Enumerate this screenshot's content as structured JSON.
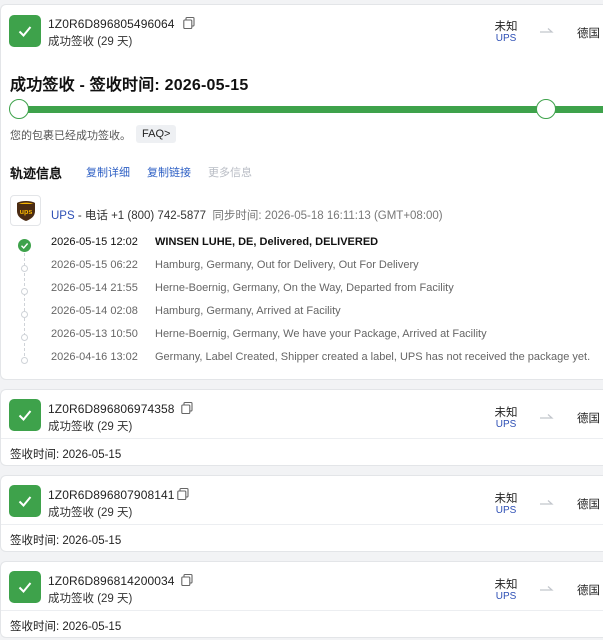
{
  "shipments": [
    {
      "tracking_no": "1Z0R6D896805496064",
      "status_sub": "成功签收 (29 天)",
      "origin": "未知",
      "carrier_short": "UPS",
      "destination": "德国"
    },
    {
      "tracking_no": "1Z0R6D896806974358",
      "status_sub": "成功签收 (29 天)",
      "origin": "未知",
      "carrier_short": "UPS",
      "destination": "德国",
      "signed_text": "签收时间: 2026-05-15"
    },
    {
      "tracking_no": "1Z0R6D896807908141",
      "status_sub": "成功签收 (29 天)",
      "origin": "未知",
      "carrier_short": "UPS",
      "destination": "德国",
      "signed_text": "签收时间: 2026-05-15"
    },
    {
      "tracking_no": "1Z0R6D896814200034",
      "status_sub": "成功签收 (29 天)",
      "origin": "未知",
      "carrier_short": "UPS",
      "destination": "德国",
      "signed_text": "签收时间: 2026-05-15"
    }
  ],
  "detail": {
    "headline": "成功签收 - 签收时间: 2026-05-15",
    "progress_fraction": 1.0,
    "delivered_message": "您的包裹已经成功签收。",
    "faq_label": "FAQ>",
    "section_title": "轨迹信息",
    "links": {
      "copy_detail": "复制详细",
      "copy_link": "复制链接",
      "more_info": "更多信息"
    },
    "carrier": {
      "name": "UPS",
      "phone": " - 电话 +1 (800) 742-5877",
      "sync": "同步时间: 2026-05-18 16:11:13 (GMT+08:00)"
    },
    "events": [
      {
        "time": "2026-05-15 12:02",
        "desc": "WINSEN LUHE, DE, Delivered, DELIVERED"
      },
      {
        "time": "2026-05-15 06:22",
        "desc": "Hamburg, Germany, Out for Delivery, Out For Delivery"
      },
      {
        "time": "2026-05-14 21:55",
        "desc": "Herne-Boernig, Germany, On the Way, Departed from Facility"
      },
      {
        "time": "2026-05-14 02:08",
        "desc": "Hamburg, Germany, Arrived at Facility"
      },
      {
        "time": "2026-05-13 10:50",
        "desc": "Herne-Boernig, Germany, We have your Package, Arrived at Facility"
      },
      {
        "time": "2026-04-16 13:02",
        "desc": "Germany, Label Created, Shipper created a label, UPS has not received the package yet."
      }
    ]
  },
  "icons": {
    "status": "check-icon",
    "copy": "copy-icon",
    "route": "arrow-right-icon",
    "carrier_logo": "ups-logo"
  },
  "colors": {
    "success_green": "#3ea24b",
    "link_blue": "#2d5fc4",
    "carrier_blue": "#2d4fb5"
  }
}
